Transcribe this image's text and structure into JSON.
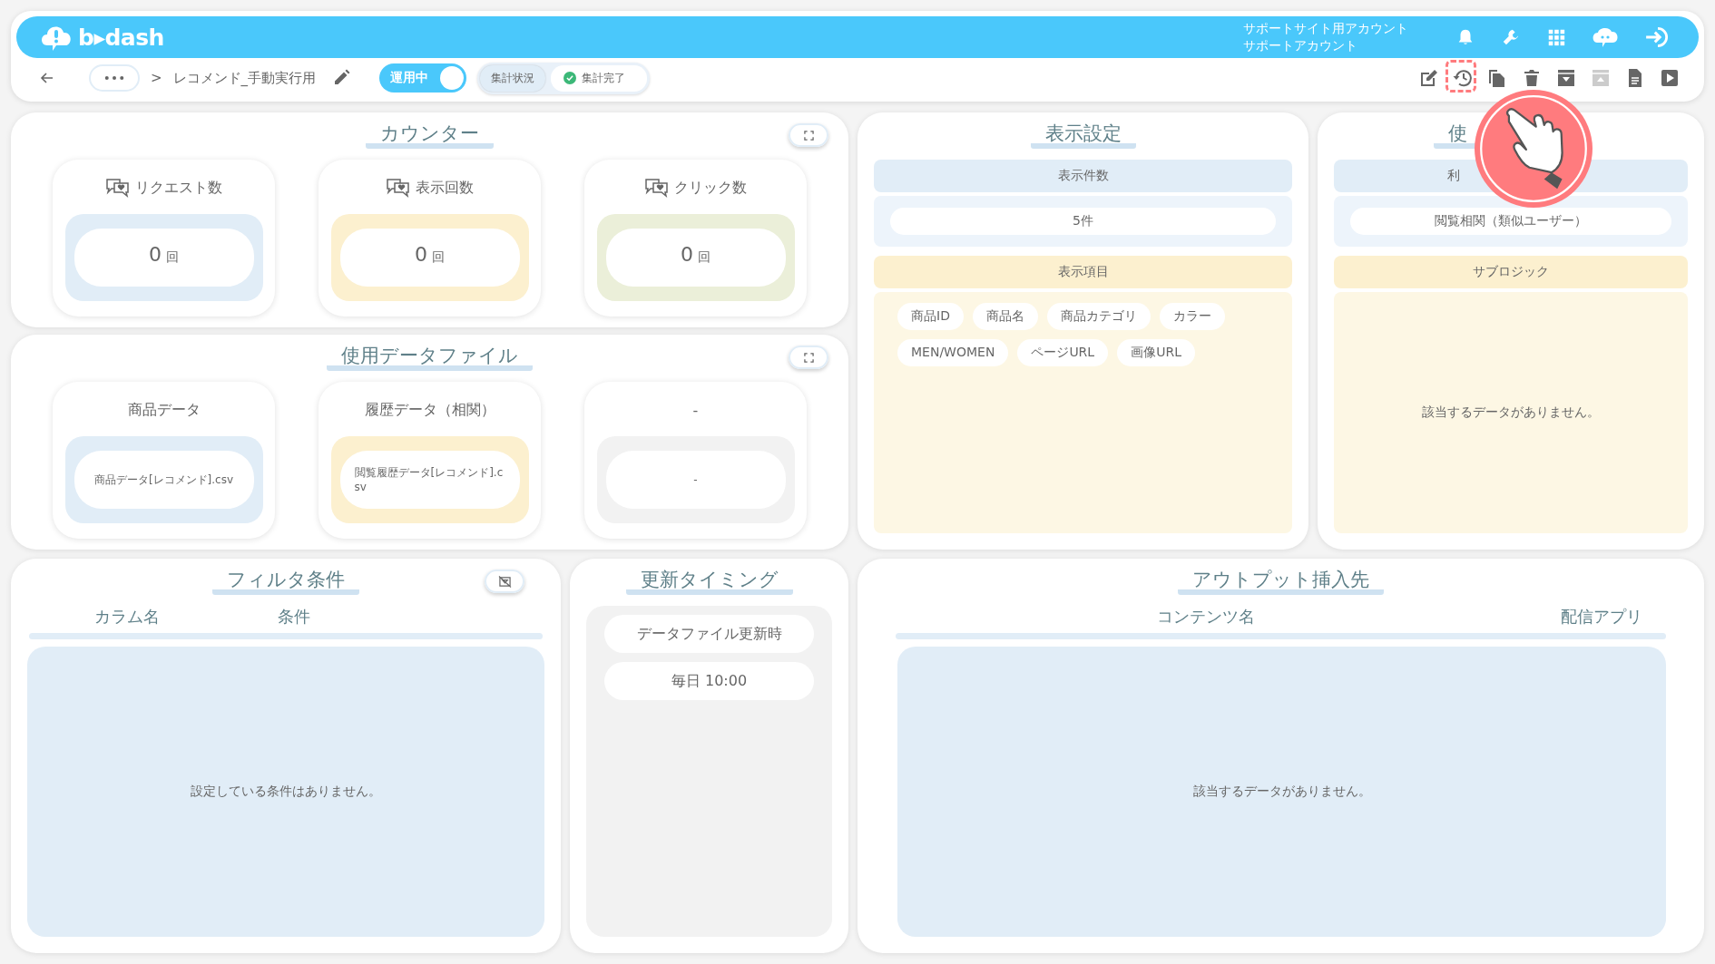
{
  "header": {
    "logo": "b▸dash",
    "account": [
      "サポートサイト用アカウント",
      "サポートアカウント"
    ],
    "icons": [
      {
        "kind": "bell"
      },
      {
        "kind": "wrench"
      },
      {
        "kind": "apps"
      },
      {
        "kind": "assistant"
      },
      {
        "kind": "logout"
      }
    ]
  },
  "nav": {
    "separator": ">",
    "breadcrumb": "レコメンド_手動実行用",
    "toggle": {
      "label": "運用中",
      "on": true
    },
    "status": {
      "label": "集計状況",
      "value": "集計完了"
    },
    "toolbar": [
      {
        "kind": "edit",
        "disabled": false,
        "highlighted": false
      },
      {
        "kind": "history",
        "disabled": false,
        "highlighted": true
      },
      {
        "kind": "copy",
        "disabled": false,
        "highlighted": false
      },
      {
        "kind": "delete",
        "disabled": false,
        "highlighted": false
      },
      {
        "kind": "download",
        "disabled": false,
        "highlighted": false
      },
      {
        "kind": "upload",
        "disabled": true,
        "highlighted": false
      },
      {
        "kind": "document",
        "disabled": false,
        "highlighted": false
      },
      {
        "kind": "play",
        "disabled": false,
        "highlighted": false
      }
    ]
  },
  "counter": {
    "title": "カウンター",
    "cards": [
      {
        "label": "リクエスト数",
        "value": "0",
        "unit": "回",
        "color": "#e1edf7"
      },
      {
        "label": "表示回数",
        "value": "0",
        "unit": "回",
        "color": "#fcf0cf"
      },
      {
        "label": "クリック数",
        "value": "0",
        "unit": "回",
        "color": "#ebefd9"
      }
    ]
  },
  "data_files": {
    "title": "使用データファイル",
    "cards": [
      {
        "label": "商品データ",
        "file": "商品データ[レコメンド].csv",
        "color": "#e1edf7"
      },
      {
        "label": "履歴データ（相関）",
        "file": "閲覧履歴データ[レコメンド].csv",
        "color": "#fcf0cf"
      },
      {
        "label": "-",
        "file": "-",
        "color": "#f2f2f2"
      }
    ]
  },
  "display": {
    "title": "表示設定",
    "count_label": "表示件数",
    "count": "5件",
    "items_label": "表示項目",
    "items": [
      "商品ID",
      "商品名",
      "商品カテゴリ",
      "カラー",
      "MEN/WOMEN",
      "ページURL",
      "画像URL"
    ]
  },
  "logic": {
    "title": "使",
    "label": "利",
    "value": "閲覧相関（類似ユーザー）",
    "sub_label": "サブロジック",
    "empty": "該当するデータがありません。"
  },
  "filter": {
    "title": "フィルタ条件",
    "columns": [
      "カラム名",
      "条件"
    ],
    "empty": "設定している条件はありません。"
  },
  "timing": {
    "title": "更新タイミング",
    "items": [
      "データファイル更新時",
      "毎日 10:00"
    ]
  },
  "output": {
    "title": "アウトプット挿入先",
    "columns": [
      "コンテンツ名",
      "配信アプリ"
    ],
    "empty": "該当するデータがありません。"
  }
}
